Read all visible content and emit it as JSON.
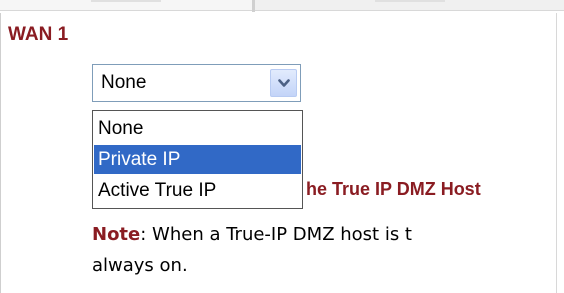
{
  "section": {
    "title": "WAN 1"
  },
  "select": {
    "selected_value": "None",
    "arrow_icon": "chevron-down-icon"
  },
  "dropdown": {
    "options": [
      {
        "label": "None",
        "highlighted": false
      },
      {
        "label": "Private IP",
        "highlighted": true
      },
      {
        "label": "Active True IP",
        "highlighted": false
      }
    ]
  },
  "behind_text": {
    "label": "he True IP DMZ Host"
  },
  "note": {
    "label": "Note",
    "line1_rest": ": When a True-IP DMZ host is t",
    "line2": "always on."
  },
  "colors": {
    "accent": "#8a1c22",
    "highlight": "#3169c6",
    "border": "#7f9db9"
  }
}
